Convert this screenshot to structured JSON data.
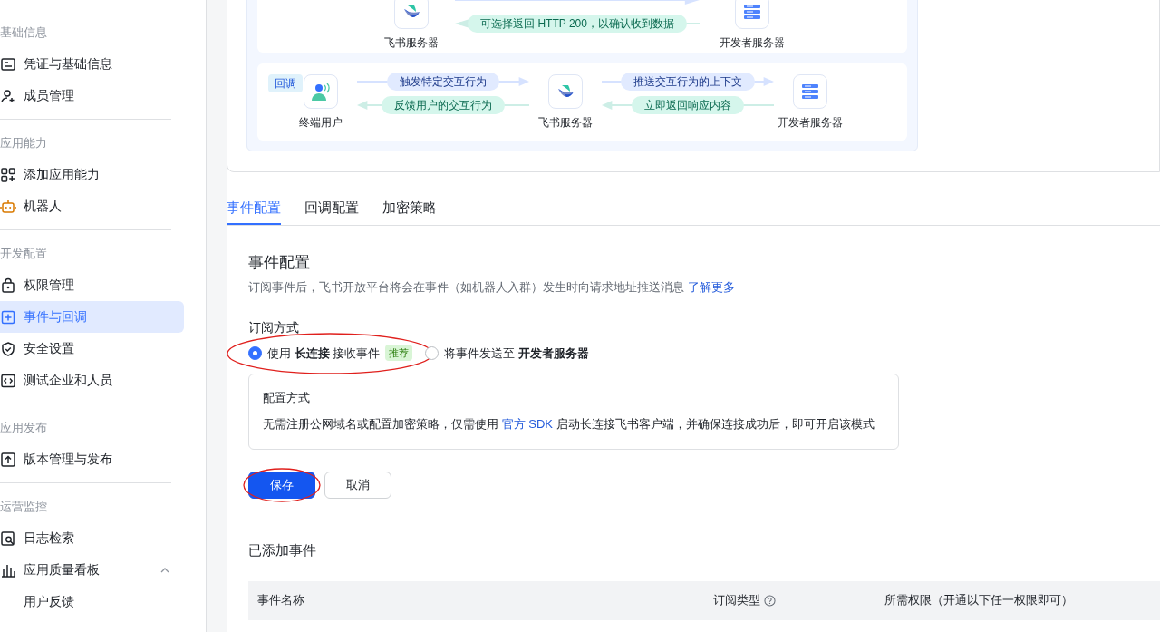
{
  "sidebar": {
    "sections": [
      {
        "title": "基础信息",
        "items": [
          {
            "label": "凭证与基础信息",
            "selected": false
          },
          {
            "label": "成员管理",
            "selected": false
          }
        ]
      },
      {
        "title": "应用能力",
        "items": [
          {
            "label": "添加应用能力",
            "selected": false
          },
          {
            "label": "机器人",
            "selected": false
          }
        ]
      },
      {
        "title": "开发配置",
        "items": [
          {
            "label": "权限管理",
            "selected": false
          },
          {
            "label": "事件与回调",
            "selected": true
          },
          {
            "label": "安全设置",
            "selected": false
          },
          {
            "label": "测试企业和人员",
            "selected": false
          }
        ]
      },
      {
        "title": "应用发布",
        "items": [
          {
            "label": "版本管理与发布",
            "selected": false
          }
        ]
      },
      {
        "title": "运营监控",
        "items": [
          {
            "label": "日志检索",
            "selected": false
          },
          {
            "label": "应用质量看板",
            "selected": false,
            "expanded": true,
            "children": [
              {
                "label": "用户反馈",
                "selected": false
              }
            ]
          }
        ]
      }
    ]
  },
  "diagram": {
    "flows": [
      {
        "nodes": [
          {
            "label": "飞书服务器",
            "kind": "feishu"
          },
          {
            "label": "开发者服务器",
            "kind": "server"
          }
        ],
        "arrows": [
          {
            "kind": "forward"
          },
          {
            "label": "可选择返回 HTTP 200，以确认收到数据",
            "kind": "back"
          }
        ]
      },
      {
        "tag": "回调",
        "nodes": [
          {
            "label": "终端用户",
            "kind": "user"
          },
          {
            "label": "飞书服务器",
            "kind": "feishu"
          },
          {
            "label": "开发者服务器",
            "kind": "server"
          }
        ],
        "arrows": [
          {
            "label": "触发特定交互行为",
            "kind": "forward"
          },
          {
            "label": "反馈用户的交互行为",
            "kind": "back"
          },
          {
            "label": "推送交互行为的上下文",
            "kind": "forward"
          },
          {
            "label": "立即返回响应内容",
            "kind": "back"
          }
        ]
      }
    ]
  },
  "tabs": [
    {
      "label": "事件配置",
      "selected": true
    },
    {
      "label": "回调配置",
      "selected": false
    },
    {
      "label": "加密策略",
      "selected": false
    }
  ],
  "event_config": {
    "title": "事件配置",
    "description": "订阅事件后，飞书开放平台将会在事件（如机器人入群）发生时向请求地址推送消息",
    "description_link": "了解更多",
    "subscription": {
      "label": "订阅方式",
      "options": [
        {
          "text": "使用 **长连接** 接收事件",
          "badge": "推荐",
          "selected": true,
          "annotated": true
        },
        {
          "text": "将事件发送至 **开发者服务器**",
          "selected": false,
          "annotated": false
        }
      ]
    },
    "mode_box": {
      "title": "配置方式",
      "text_before": "无需注册公网域名或配置加密策略，仅需使用 ",
      "link": "官方 SDK",
      "text_after": " 启动长连接飞书客户端，并确保连接成功后，即可开启该模式"
    },
    "buttons": [
      {
        "label": "保存",
        "kind": "primary",
        "annotated": true
      },
      {
        "label": "取消",
        "kind": "secondary",
        "annotated": false
      }
    ]
  },
  "added_events": {
    "title": "已添加事件",
    "columns": [
      {
        "label": "事件名称",
        "help": false
      },
      {
        "label": "订阅类型",
        "help": true
      },
      {
        "label": "所需权限（开通以下任一权限即可）",
        "help": false
      }
    ]
  }
}
